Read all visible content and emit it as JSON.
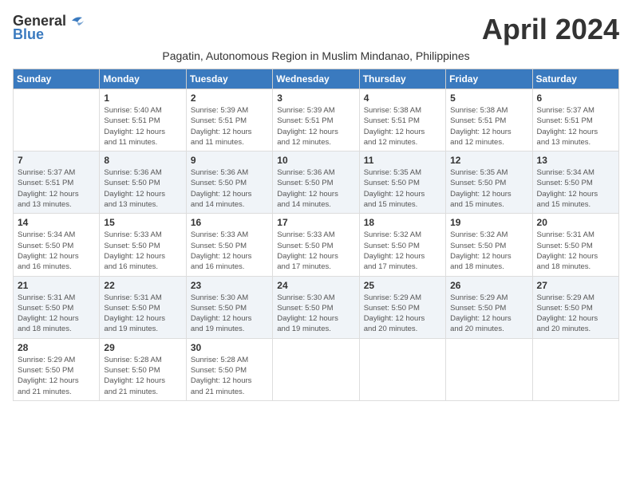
{
  "header": {
    "logo_general": "General",
    "logo_blue": "Blue",
    "month_title": "April 2024",
    "subtitle": "Pagatin, Autonomous Region in Muslim Mindanao, Philippines"
  },
  "days_of_week": [
    "Sunday",
    "Monday",
    "Tuesday",
    "Wednesday",
    "Thursday",
    "Friday",
    "Saturday"
  ],
  "weeks": [
    [
      {
        "day": "",
        "info": ""
      },
      {
        "day": "1",
        "info": "Sunrise: 5:40 AM\nSunset: 5:51 PM\nDaylight: 12 hours\nand 11 minutes."
      },
      {
        "day": "2",
        "info": "Sunrise: 5:39 AM\nSunset: 5:51 PM\nDaylight: 12 hours\nand 11 minutes."
      },
      {
        "day": "3",
        "info": "Sunrise: 5:39 AM\nSunset: 5:51 PM\nDaylight: 12 hours\nand 12 minutes."
      },
      {
        "day": "4",
        "info": "Sunrise: 5:38 AM\nSunset: 5:51 PM\nDaylight: 12 hours\nand 12 minutes."
      },
      {
        "day": "5",
        "info": "Sunrise: 5:38 AM\nSunset: 5:51 PM\nDaylight: 12 hours\nand 12 minutes."
      },
      {
        "day": "6",
        "info": "Sunrise: 5:37 AM\nSunset: 5:51 PM\nDaylight: 12 hours\nand 13 minutes."
      }
    ],
    [
      {
        "day": "7",
        "info": "Sunrise: 5:37 AM\nSunset: 5:51 PM\nDaylight: 12 hours\nand 13 minutes."
      },
      {
        "day": "8",
        "info": "Sunrise: 5:36 AM\nSunset: 5:50 PM\nDaylight: 12 hours\nand 13 minutes."
      },
      {
        "day": "9",
        "info": "Sunrise: 5:36 AM\nSunset: 5:50 PM\nDaylight: 12 hours\nand 14 minutes."
      },
      {
        "day": "10",
        "info": "Sunrise: 5:36 AM\nSunset: 5:50 PM\nDaylight: 12 hours\nand 14 minutes."
      },
      {
        "day": "11",
        "info": "Sunrise: 5:35 AM\nSunset: 5:50 PM\nDaylight: 12 hours\nand 15 minutes."
      },
      {
        "day": "12",
        "info": "Sunrise: 5:35 AM\nSunset: 5:50 PM\nDaylight: 12 hours\nand 15 minutes."
      },
      {
        "day": "13",
        "info": "Sunrise: 5:34 AM\nSunset: 5:50 PM\nDaylight: 12 hours\nand 15 minutes."
      }
    ],
    [
      {
        "day": "14",
        "info": "Sunrise: 5:34 AM\nSunset: 5:50 PM\nDaylight: 12 hours\nand 16 minutes."
      },
      {
        "day": "15",
        "info": "Sunrise: 5:33 AM\nSunset: 5:50 PM\nDaylight: 12 hours\nand 16 minutes."
      },
      {
        "day": "16",
        "info": "Sunrise: 5:33 AM\nSunset: 5:50 PM\nDaylight: 12 hours\nand 16 minutes."
      },
      {
        "day": "17",
        "info": "Sunrise: 5:33 AM\nSunset: 5:50 PM\nDaylight: 12 hours\nand 17 minutes."
      },
      {
        "day": "18",
        "info": "Sunrise: 5:32 AM\nSunset: 5:50 PM\nDaylight: 12 hours\nand 17 minutes."
      },
      {
        "day": "19",
        "info": "Sunrise: 5:32 AM\nSunset: 5:50 PM\nDaylight: 12 hours\nand 18 minutes."
      },
      {
        "day": "20",
        "info": "Sunrise: 5:31 AM\nSunset: 5:50 PM\nDaylight: 12 hours\nand 18 minutes."
      }
    ],
    [
      {
        "day": "21",
        "info": "Sunrise: 5:31 AM\nSunset: 5:50 PM\nDaylight: 12 hours\nand 18 minutes."
      },
      {
        "day": "22",
        "info": "Sunrise: 5:31 AM\nSunset: 5:50 PM\nDaylight: 12 hours\nand 19 minutes."
      },
      {
        "day": "23",
        "info": "Sunrise: 5:30 AM\nSunset: 5:50 PM\nDaylight: 12 hours\nand 19 minutes."
      },
      {
        "day": "24",
        "info": "Sunrise: 5:30 AM\nSunset: 5:50 PM\nDaylight: 12 hours\nand 19 minutes."
      },
      {
        "day": "25",
        "info": "Sunrise: 5:29 AM\nSunset: 5:50 PM\nDaylight: 12 hours\nand 20 minutes."
      },
      {
        "day": "26",
        "info": "Sunrise: 5:29 AM\nSunset: 5:50 PM\nDaylight: 12 hours\nand 20 minutes."
      },
      {
        "day": "27",
        "info": "Sunrise: 5:29 AM\nSunset: 5:50 PM\nDaylight: 12 hours\nand 20 minutes."
      }
    ],
    [
      {
        "day": "28",
        "info": "Sunrise: 5:29 AM\nSunset: 5:50 PM\nDaylight: 12 hours\nand 21 minutes."
      },
      {
        "day": "29",
        "info": "Sunrise: 5:28 AM\nSunset: 5:50 PM\nDaylight: 12 hours\nand 21 minutes."
      },
      {
        "day": "30",
        "info": "Sunrise: 5:28 AM\nSunset: 5:50 PM\nDaylight: 12 hours\nand 21 minutes."
      },
      {
        "day": "",
        "info": ""
      },
      {
        "day": "",
        "info": ""
      },
      {
        "day": "",
        "info": ""
      },
      {
        "day": "",
        "info": ""
      }
    ]
  ]
}
